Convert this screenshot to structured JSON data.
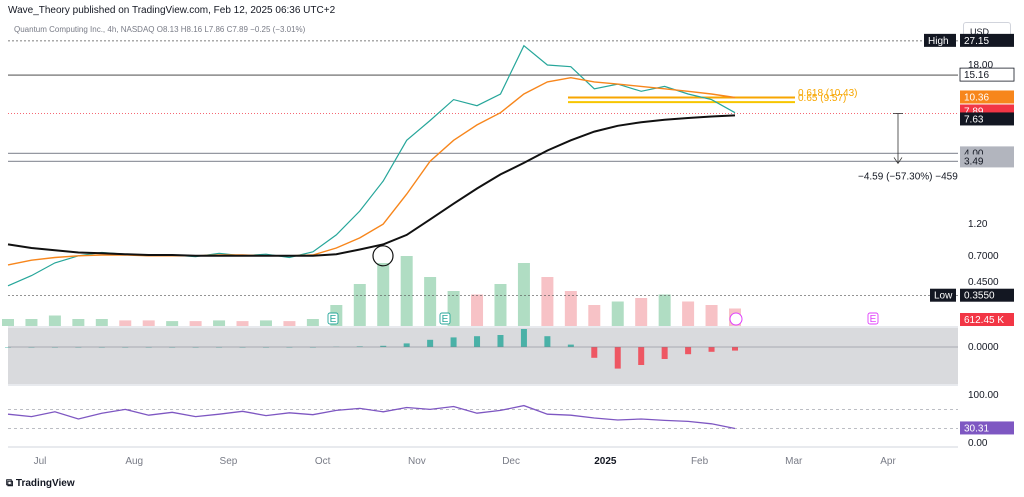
{
  "header": {
    "publisher": "Wave_Theory published on TradingView.com, Feb 12, 2025 06:36 UTC+2",
    "symbol": "Quantum Computing Inc., 4h, NASDAQ",
    "ohlc": "O8.13 H8.16 L7.86 C7.89 −0.25 (−3.01%)",
    "currency": "USD"
  },
  "footer": {
    "brand": "TradingView"
  },
  "chart_data": {
    "type": "line",
    "x": [
      "Jul",
      "Aug",
      "Sep",
      "Oct",
      "Nov",
      "Dec",
      "2025",
      "Feb",
      "Mar",
      "Apr"
    ],
    "price_axis_scale": "log",
    "price_axis_ticks": [
      "18.00",
      "1.20",
      "0.7000",
      "0.4500",
      "0.0000",
      "100.00",
      "0.00"
    ],
    "price_labels": [
      {
        "name": "High",
        "value": "27.15",
        "style": "black"
      },
      {
        "name": "",
        "value": "15.16",
        "style": "white"
      },
      {
        "name": "",
        "value": "10.36",
        "style": "orange"
      },
      {
        "name": "",
        "value": "7.89",
        "style": "red"
      },
      {
        "name": "",
        "value": "7.63",
        "style": "black"
      },
      {
        "name": "",
        "value": "4.00",
        "style": "gray"
      },
      {
        "name": "",
        "value": "3.49",
        "style": "gray"
      },
      {
        "name": "Low",
        "value": "0.3550",
        "style": "black"
      },
      {
        "name": "",
        "value": "612.45 K",
        "style": "red"
      },
      {
        "name": "",
        "value": "30.31",
        "style": "purple"
      }
    ],
    "fib_labels": [
      "0.618 (10.43)",
      "0.65 (9.57)"
    ],
    "measure_label": "−4.59 (−57.30%) −459",
    "events": [
      "E",
      "E",
      "E"
    ],
    "series": [
      {
        "values": [
          0.42,
          0.5,
          0.62,
          0.7,
          0.74,
          0.72,
          0.7,
          0.71,
          0.69,
          0.73,
          0.7,
          0.72,
          0.68,
          0.75,
          1.0,
          1.5,
          2.5,
          5.0,
          7.0,
          10.0,
          9.0,
          11.0,
          25.0,
          18.0,
          17.5,
          12.0,
          13.0,
          11.5,
          12.5,
          11.0,
          10.0,
          8.0
        ]
      },
      {
        "values": [
          0.6,
          0.65,
          0.68,
          0.7,
          0.71,
          0.71,
          0.7,
          0.7,
          0.7,
          0.71,
          0.71,
          0.7,
          0.7,
          0.71,
          0.8,
          0.95,
          1.2,
          2.0,
          3.5,
          5.0,
          6.5,
          8.0,
          11.0,
          13.5,
          14.5,
          13.5,
          13.0,
          12.5,
          12.0,
          11.5,
          11.0,
          10.36
        ]
      },
      {
        "values": [
          0.85,
          0.8,
          0.77,
          0.74,
          0.73,
          0.72,
          0.71,
          0.71,
          0.7,
          0.7,
          0.7,
          0.7,
          0.7,
          0.7,
          0.72,
          0.78,
          0.85,
          1.0,
          1.3,
          1.7,
          2.2,
          2.8,
          3.4,
          4.2,
          5.0,
          5.8,
          6.4,
          6.8,
          7.1,
          7.3,
          7.5,
          7.63
        ]
      }
    ],
    "rsi_values": [
      60,
      55,
      65,
      50,
      62,
      70,
      58,
      64,
      55,
      60,
      66,
      57,
      63,
      59,
      68,
      72,
      65,
      74,
      70,
      76,
      62,
      68,
      78,
      60,
      58,
      52,
      48,
      50,
      47,
      45,
      40,
      30.31
    ],
    "macd_values": [
      0,
      0,
      0,
      0,
      0,
      0,
      0,
      0,
      0,
      0,
      0,
      0,
      0,
      0,
      0.02,
      0.05,
      0.1,
      0.3,
      0.6,
      0.8,
      0.9,
      1.0,
      1.5,
      0.9,
      0.2,
      -0.9,
      -1.8,
      -1.5,
      -1.0,
      -0.6,
      -0.4,
      -0.3
    ],
    "volume_values": [
      0.1,
      0.1,
      0.15,
      0.1,
      0.1,
      0.08,
      0.08,
      0.07,
      0.07,
      0.08,
      0.07,
      0.08,
      0.07,
      0.1,
      0.3,
      0.6,
      0.9,
      1.0,
      0.7,
      0.5,
      0.45,
      0.6,
      0.9,
      0.7,
      0.5,
      0.3,
      0.35,
      0.4,
      0.45,
      0.35,
      0.3,
      0.25
    ]
  }
}
